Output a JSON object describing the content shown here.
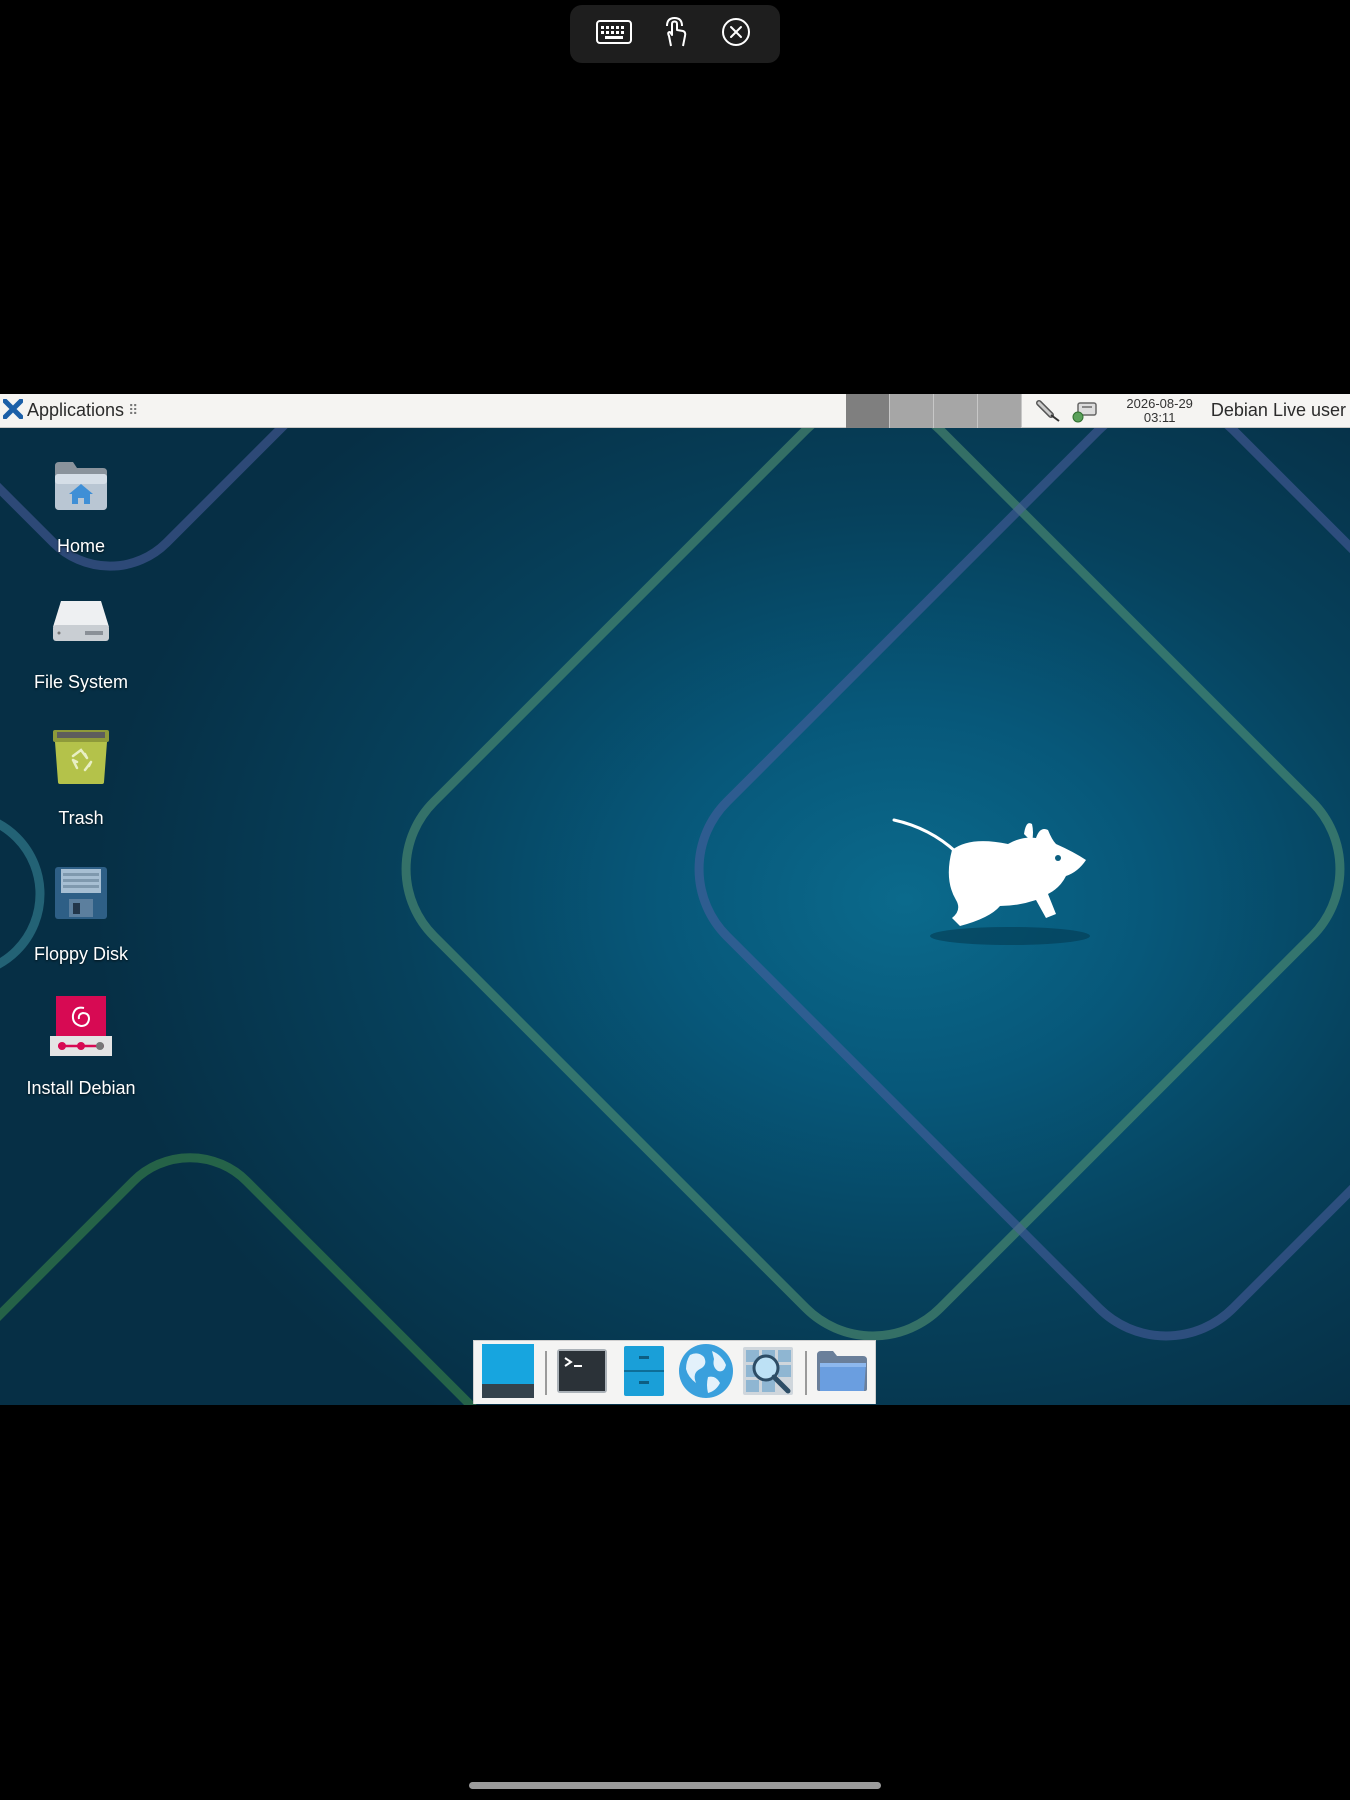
{
  "viewer_toolbar": {
    "icons": [
      "keyboard-icon",
      "touch-gesture-icon",
      "close-circle-icon"
    ]
  },
  "panel": {
    "applications_label": "Applications",
    "applications_handle": "⠿",
    "workspaces": [
      {
        "name": "workspace-1",
        "active": true
      },
      {
        "name": "workspace-2",
        "active": false
      },
      {
        "name": "workspace-3",
        "active": false
      },
      {
        "name": "workspace-4",
        "active": false
      }
    ],
    "tray_icons": [
      "usb-icon",
      "network-icon"
    ],
    "clock_date": "2026-08-29",
    "clock_time": "03:11",
    "user_label": "Debian Live user"
  },
  "desktop_icons": [
    {
      "label": "Home",
      "icon": "home-folder-icon"
    },
    {
      "label": "File System",
      "icon": "hard-drive-icon"
    },
    {
      "label": "Trash",
      "icon": "trash-icon"
    },
    {
      "label": "Floppy Disk",
      "icon": "floppy-disk-icon"
    },
    {
      "label": "Install Debian",
      "icon": "debian-installer-icon"
    }
  ],
  "dock_items": [
    "show-desktop-icon",
    "terminal-icon",
    "file-manager-icon",
    "web-browser-icon",
    "app-finder-icon",
    "folder-icon"
  ],
  "colors": {
    "panel_bg": "#f5f4f2",
    "desktop_center": "#0b6a8c",
    "desktop_edge": "#062f45",
    "line_green": "#5e9a6e",
    "line_blue": "#5060a0"
  }
}
